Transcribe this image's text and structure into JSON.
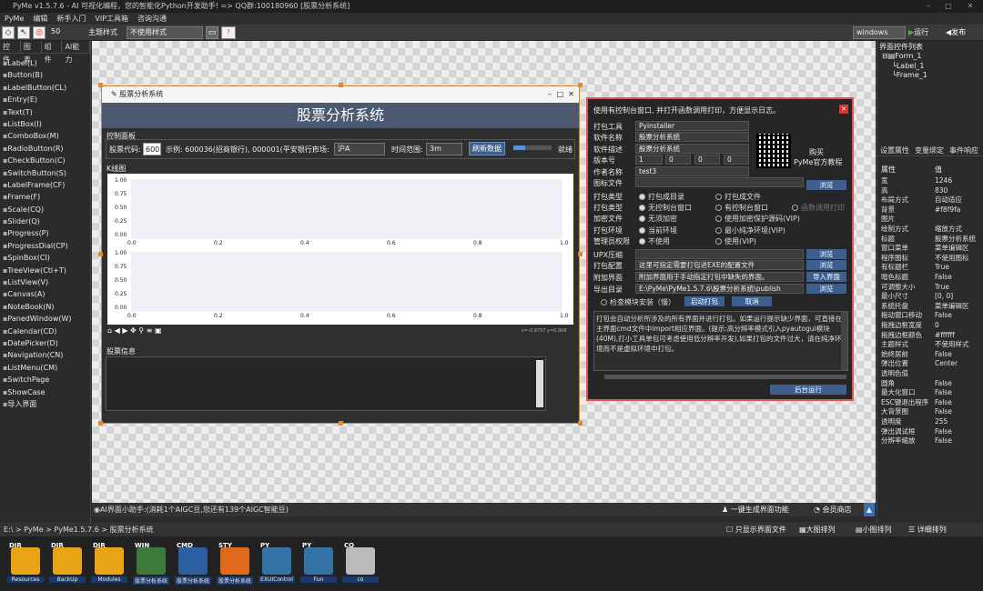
{
  "titlebar": {
    "title": "PyMe v1.5.7.6 - AI 可视化编程，您的智能化Python开发助手!   => QQ群:100180960   [股票分析系统]"
  },
  "menu": [
    "PyMe",
    "编辑",
    "新手入门",
    "VIP工具箱",
    "咨询沟通"
  ],
  "toolbar": {
    "size_value": "50",
    "theme_label": "主题样式",
    "theme_value": "不使用样式",
    "platform": "windows",
    "run_label": "运行",
    "publish_label": "发布"
  },
  "left_tabs": [
    "控件",
    "图表",
    "组件",
    "AI能力"
  ],
  "controls": [
    "Label(L)",
    "Button(B)",
    "LabelButton(CL)",
    "Entry(E)",
    "Text(T)",
    "ListBox(I)",
    "ComboBox(M)",
    "RadioButton(R)",
    "CheckButton(C)",
    "SwitchButton(S)",
    "LabelFrame(CF)",
    "Frame(F)",
    "Scale(CQ)",
    "Slider(Q)",
    "Progress(P)",
    "ProgressDial(CP)",
    "SpinBox(CI)",
    "TreeView(Ctl+T)",
    "ListView(V)",
    "Canvas(A)",
    "NoteBook(N)",
    "PanedWindow(W)",
    "Calendar(CD)",
    "DatePicker(D)",
    "Navigation(CN)",
    "ListMenu(CM)",
    "SwitchPage",
    "ShowCase",
    "导入界面"
  ],
  "form": {
    "window_title": "股票分析系统",
    "banner": "股票分析系统",
    "control_panel": "控制面板",
    "code_label": "股票代码:",
    "code_value": "600",
    "example": "示例: 600036(招商银行), 000001(平安银行)",
    "market_label": "市场:",
    "market_value": "沪A",
    "range_label": "时间范围:",
    "range_value": "3m",
    "refresh": "刷新数据",
    "status": "就绪",
    "kline": "K线图",
    "y_ticks": [
      "1.00",
      "0.75",
      "0.50",
      "0.25",
      "0.00"
    ],
    "x_ticks": [
      "0.0",
      "0.2",
      "0.4",
      "0.6",
      "0.8",
      "1.0"
    ],
    "coords": "x=-0.9757  y=0.908",
    "info": "股票信息"
  },
  "dialog": {
    "header": "使用有控制台窗口, 并打开函数调用打印，方便显示日志。",
    "rows": [
      {
        "label": "打包工具",
        "value": "Pyinstaller"
      },
      {
        "label": "软件名称",
        "value": "股票分析系统"
      },
      {
        "label": "软件描述",
        "value": "股票分析系统"
      },
      {
        "label": "版本号",
        "value": "1"
      },
      {
        "label": "作者名称",
        "value": "test3"
      },
      {
        "label": "图标文件",
        "value": ""
      }
    ],
    "version_parts": [
      "0",
      "0",
      "0"
    ],
    "buy_label": "购买",
    "buy_sub": "PyMe官方教程",
    "browse": "浏览",
    "options": [
      {
        "label": "打包类型",
        "a": "打包成目录",
        "b": "打包成文件",
        "c": ""
      },
      {
        "label": "打包类型",
        "a": "无控制台窗口",
        "b": "有控制台窗口",
        "c": "函数调用打印"
      },
      {
        "label": "加密文件",
        "a": "无须加密",
        "b": "使用加密保护源码(VIP)",
        "c": ""
      },
      {
        "label": "打包环境",
        "a": "当前环境",
        "b": "最小纯净环境(VIP)",
        "c": ""
      },
      {
        "label": "管理员权限",
        "a": "不使用",
        "b": "使用(VIP)",
        "c": ""
      }
    ],
    "upx": "UPX压缩",
    "config_label": "打包配置",
    "config_value": "这里可指定需要打包进EXE的配置文件",
    "attach_label": "附加界面",
    "attach_value": "附加界面用于手动指定打包中缺失的界面。",
    "import_btn": "导入界面",
    "export_label": "导出目录",
    "export_value": "E:\\PyMe\\PyMe1.5.7.6\\股票分析系统\\publish",
    "check_module": "检查模块安装（慢）",
    "start": "启动打包",
    "cancel": "取消",
    "log": "打包会自动分析所涉及的所有界面并进行打包。如果运行提示缺少界面，可直接在主界面cmd文件中import相应界面。(提示:高分辨率模式引入pyautogui模块(40M),打小工具单包可考虑使用低分辨率开发),如果打包的文件过大，请在纯净环境而不是虚拟环境中打包。",
    "bg_run": "后台运行"
  },
  "right": {
    "tree_title": "界面控件列表",
    "tree": [
      "Form_1",
      "Label_1",
      "Frame_1"
    ],
    "tabs": [
      "设置属性",
      "变量绑定",
      "事件响应"
    ],
    "col_attr": "属性",
    "col_val": "值",
    "props": [
      [
        "宽",
        "1246"
      ],
      [
        "高",
        "830"
      ],
      [
        "布局方式",
        "自动适应"
      ],
      [
        "背景",
        "#f8f9fa"
      ],
      [
        "图片",
        ""
      ],
      [
        "绘制方式",
        "缩放方式"
      ],
      [
        "标题",
        "股票分析系统"
      ],
      [
        "窗口菜单",
        "菜单编辑区"
      ],
      [
        "程序图标",
        "不使用图标"
      ],
      [
        "有标题栏",
        "True"
      ],
      [
        "暗色标题",
        "False"
      ],
      [
        "可调整大小",
        "True"
      ],
      [
        "最小尺寸",
        "[0, 0]"
      ],
      [
        "系统托盘",
        "菜单编辑区"
      ],
      [
        "拖动窗口移动",
        "False"
      ],
      [
        "拖拽边框宽度",
        "0"
      ],
      [
        "拖拽边框颜色",
        "#ffffff"
      ],
      [
        "主题样式",
        "不使用样式"
      ],
      [
        "始终居前",
        "False"
      ],
      [
        "弹出位置",
        "Center"
      ],
      [
        "透明色值",
        ""
      ],
      [
        "圆角",
        "False"
      ],
      [
        "最大化窗口",
        "False"
      ],
      [
        "ESC键退出程序",
        "False"
      ],
      [
        "大背景图",
        "False"
      ],
      [
        "透明度",
        "255"
      ],
      [
        "弹出调试框",
        "False"
      ],
      [
        "分辨率缩放",
        "False"
      ]
    ]
  },
  "status": {
    "assistant": "AI界面小助手:(消耗1个AIGC豆,您还有139个AIGC智能豆)",
    "gen": "一键生成界面功能",
    "shop": "会员商店"
  },
  "path": {
    "text": "E:\\ > PyMe > PyMe1.5.7.6 > 股票分析系统",
    "only_ui": "只显示界面文件",
    "big": "大图排列",
    "small": "小图排列",
    "detail": "详细排列"
  },
  "files": [
    {
      "tag": "DIR",
      "name": "Resources",
      "color": "#e8a317"
    },
    {
      "tag": "DIR",
      "name": "BackUp",
      "color": "#e8a317"
    },
    {
      "tag": "DIR",
      "name": "Modules",
      "color": "#e8a317"
    },
    {
      "tag": "WIN",
      "name": "股票分析系统",
      "color": "#3b7a3b"
    },
    {
      "tag": "CMD",
      "name": "股票分析系统",
      "color": "#2d5fa3"
    },
    {
      "tag": "STY",
      "name": "股票分析系统",
      "color": "#e06a1a"
    },
    {
      "tag": "PY",
      "name": "EXUIControl",
      "color": "#3572a5"
    },
    {
      "tag": "PY",
      "name": "Fun",
      "color": "#3572a5"
    },
    {
      "tag": "CO",
      "name": "co",
      "color": "#bbbbbb"
    }
  ]
}
